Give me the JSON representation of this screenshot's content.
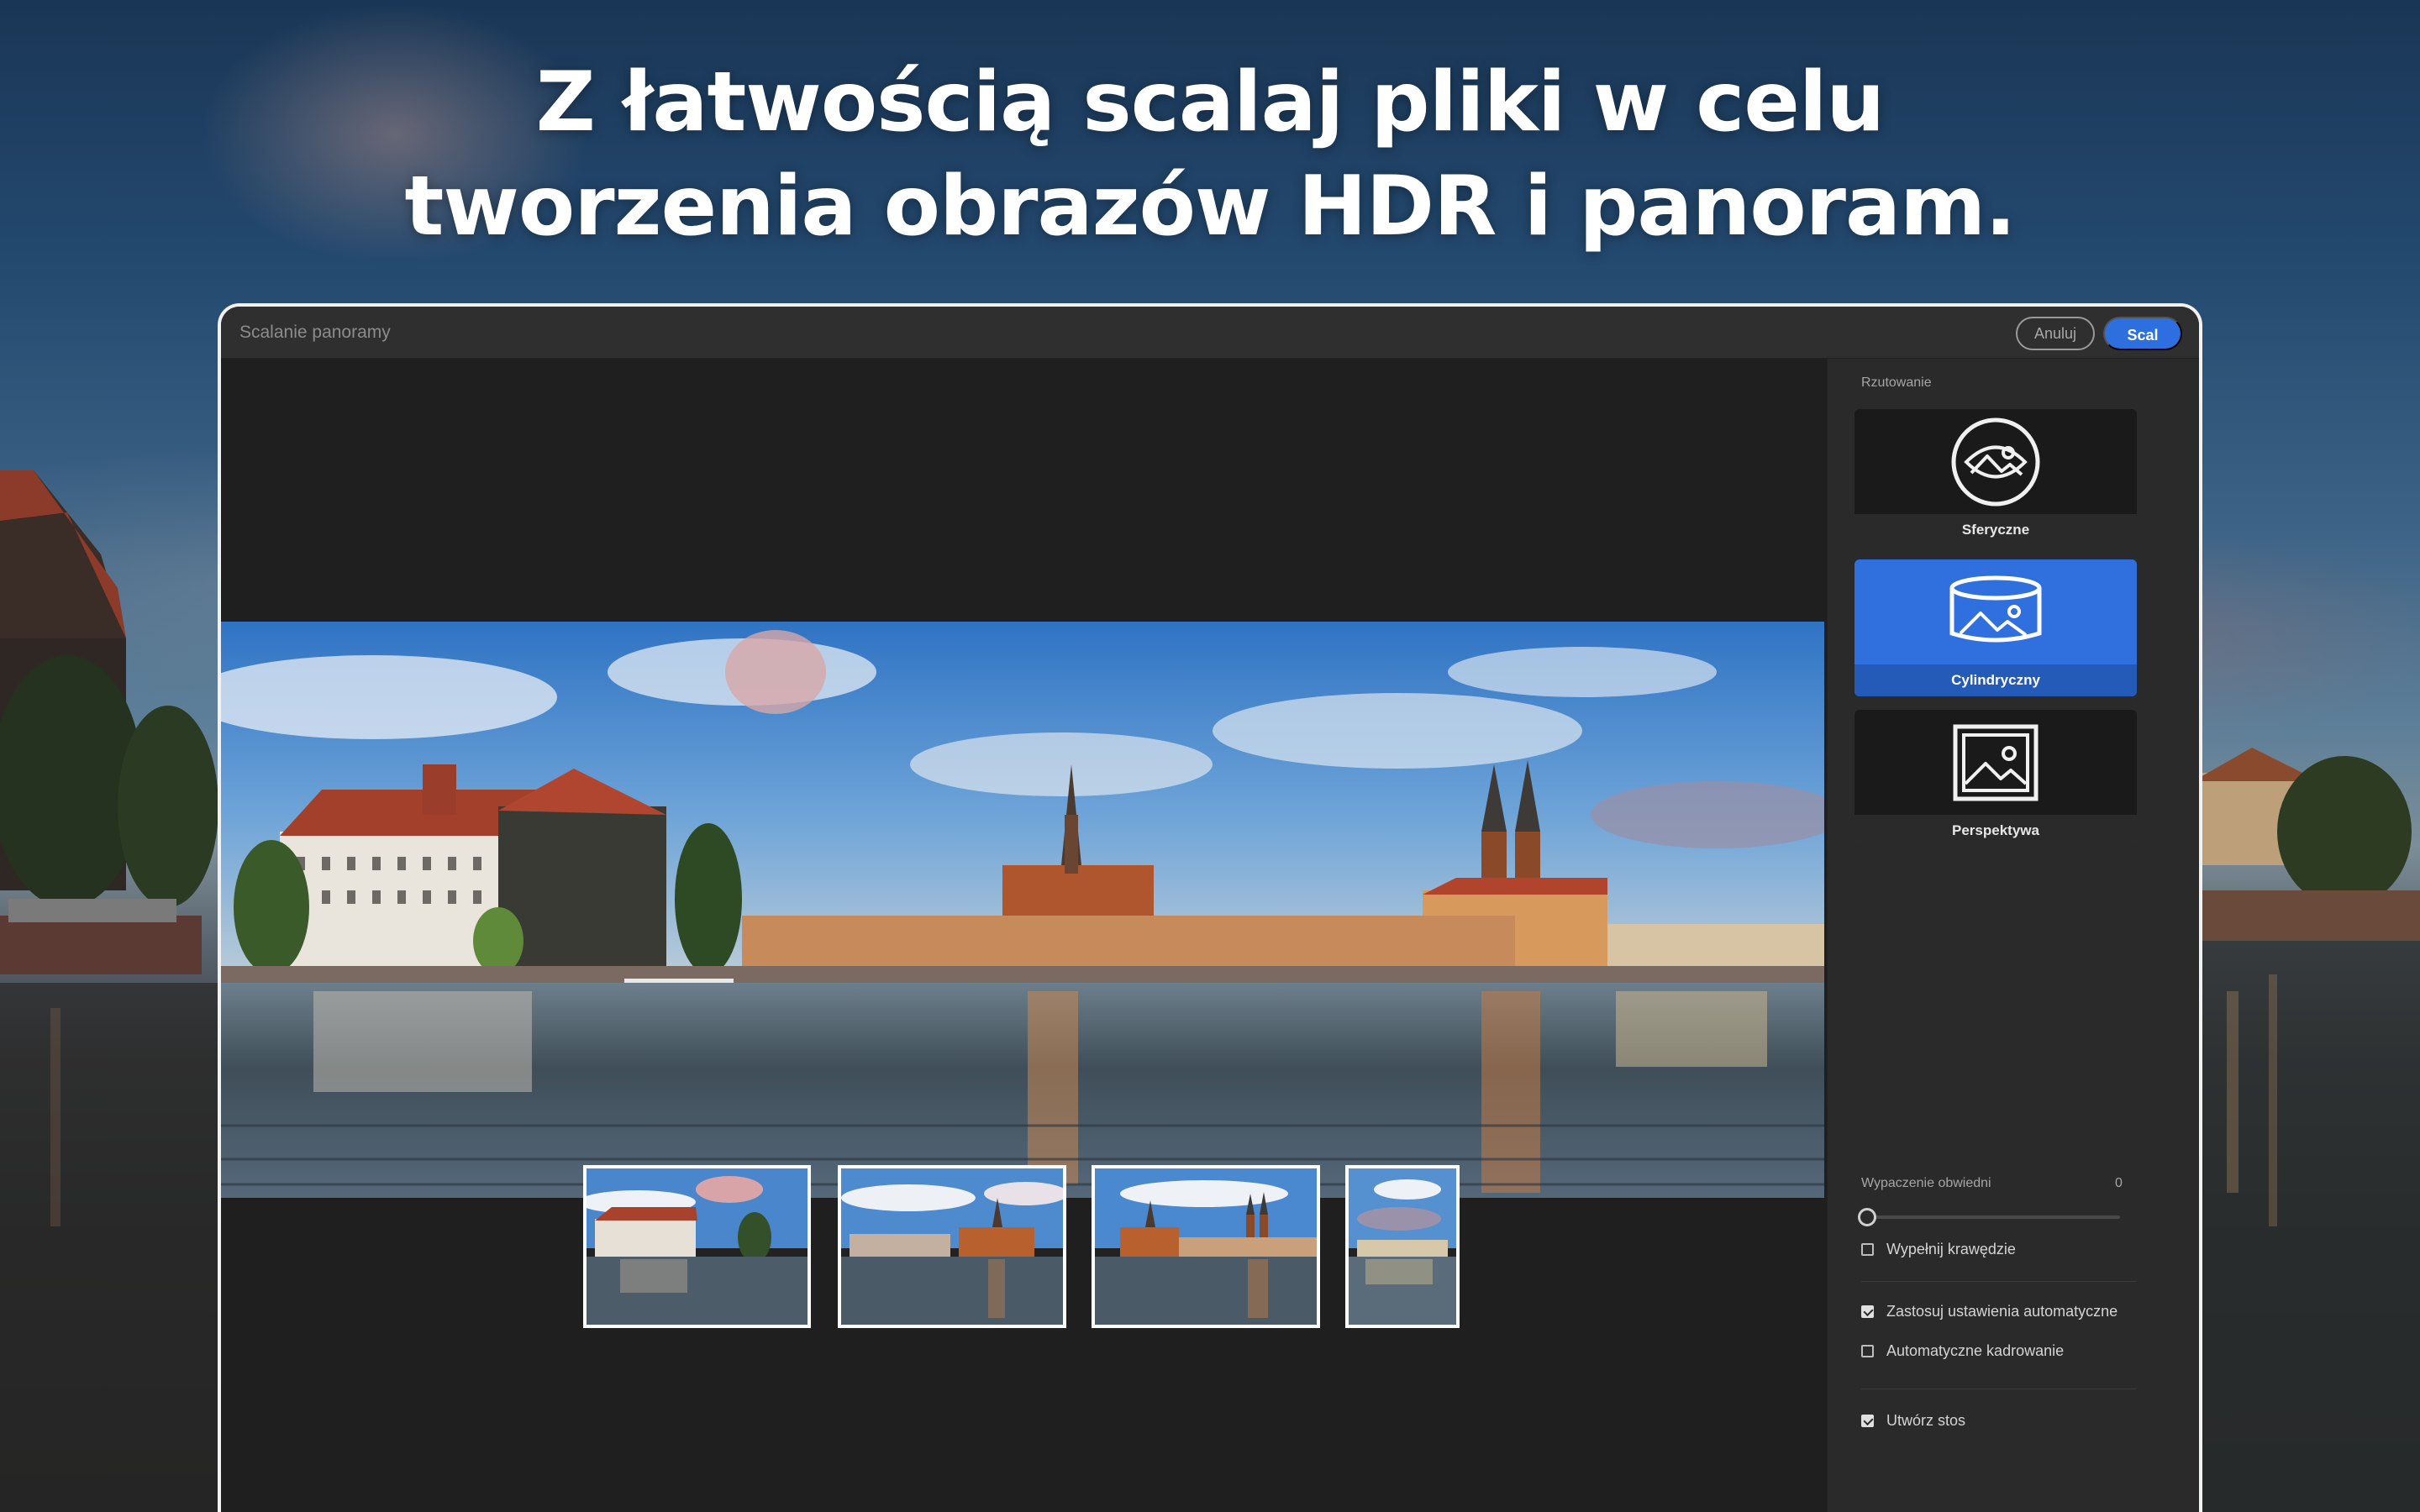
{
  "headline": {
    "line1": "Z łatwością scalaj pliki w celu",
    "line2": "tworzenia obrazów HDR i panoram."
  },
  "dialog": {
    "title": "Scalanie panoramy",
    "cancel_label": "Anuluj",
    "merge_label": "Scal"
  },
  "panel": {
    "projection_label": "Rzutowanie",
    "projections": [
      {
        "label": "Sferyczne",
        "icon": "spherical-projection-icon",
        "selected": false
      },
      {
        "label": "Cylindryczny",
        "icon": "cylindrical-projection-icon",
        "selected": true
      },
      {
        "label": "Perspektywa",
        "icon": "perspective-projection-icon",
        "selected": false
      }
    ],
    "boundary_warp_label": "Wypaczenie obwiedni",
    "boundary_warp_value": "0",
    "fill_edges_label": "Wypełnij krawędzie",
    "fill_edges_checked": false,
    "auto_settings_label": "Zastosuj ustawienia automatyczne",
    "auto_settings_checked": true,
    "auto_crop_label": "Automatyczne kadrowanie",
    "auto_crop_checked": false,
    "create_stack_label": "Utwórz stos",
    "create_stack_checked": true
  },
  "colors": {
    "accent": "#2d6fde",
    "panel_bg": "#2a2a2a",
    "canvas_bg": "#1f1f1f"
  }
}
